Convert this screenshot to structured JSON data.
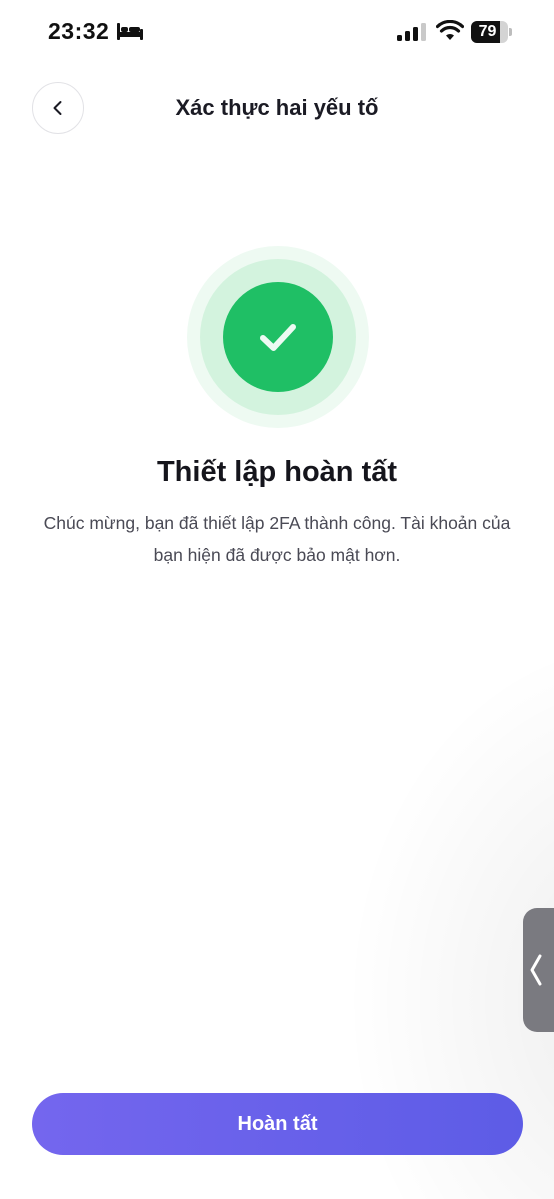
{
  "status_bar": {
    "time": "23:32",
    "battery_level": 79,
    "battery_text": "79",
    "icons": [
      "bed-icon",
      "cellular-signal-icon",
      "wifi-icon",
      "battery-icon"
    ]
  },
  "header": {
    "back_icon": "chevron-left-icon",
    "title": "Xác thực hai yếu tố"
  },
  "success": {
    "icon": "checkmark-icon",
    "title": "Thiết lập hoàn tất",
    "message": "Chúc mừng, bạn đã thiết lập 2FA thành công. Tài khoản của bạn hiện đã được bảo mật hơn."
  },
  "side_handle": {
    "icon": "chevron-left-icon"
  },
  "footer": {
    "done_label": "Hoàn tất"
  },
  "colors": {
    "accent": "#6a61ea",
    "success_green": "#1fbf65",
    "ring_light": "#d3f3de",
    "ring_lighter": "#eefaf2",
    "text_primary": "#1b1b24",
    "text_secondary": "#4a4a55"
  }
}
